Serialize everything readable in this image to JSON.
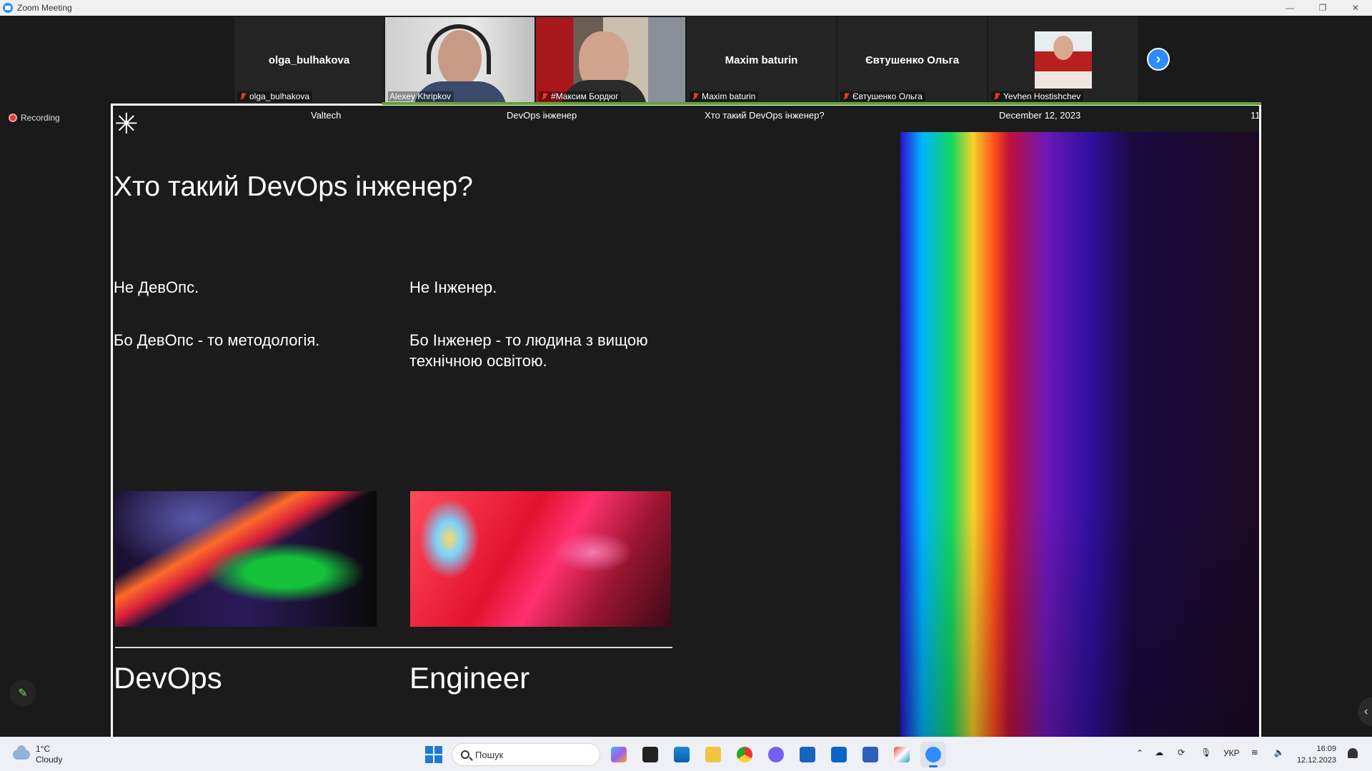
{
  "window": {
    "title": "Zoom Meeting"
  },
  "participants": [
    {
      "name": "olga_bulhakova",
      "center_name": "olga_bulhakova",
      "muted": true,
      "video": false
    },
    {
      "name": "Alexey Khripkov",
      "muted": false,
      "video": true,
      "active_speaker": true
    },
    {
      "name": "#Максим Бордюг",
      "muted": true,
      "video": true
    },
    {
      "name": "Maxim baturin",
      "center_name": "Maxim baturin",
      "muted": true,
      "video": false
    },
    {
      "name": "Євтушенко Ольга",
      "center_name": "Євтушенко Ольга",
      "muted": true,
      "video": false
    },
    {
      "name": "Yevhen Hostishchev",
      "muted": true,
      "video": false,
      "avatar": true
    }
  ],
  "recording": {
    "label": "Recording"
  },
  "slide": {
    "header": {
      "company": "Valtech",
      "section": "DevOps інженер",
      "topic": "Хто такий DevOps інженер?",
      "date": "December 12, 2023",
      "page": "11"
    },
    "title": "Хто такий DevOps інженер?",
    "col1": {
      "line1": "Не ДевОпс.",
      "line2": "Бо ДевОпс - то методологія."
    },
    "col2": {
      "line1": "Не Інженер.",
      "line2a": "Бо Інженер - то людина з вищою",
      "line2b": "технічною освітою."
    },
    "word1": "DevOps",
    "word2": "Engineer"
  },
  "taskbar": {
    "weather": {
      "temp": "1°C",
      "condition": "Cloudy"
    },
    "search_placeholder": "Пошук",
    "apps": [
      "copilot",
      "task-view",
      "store",
      "file-explorer",
      "chrome",
      "viber",
      "remote-desktop",
      "outlook",
      "word",
      "snipping-tool",
      "zoom"
    ],
    "language": "УКР",
    "time": "16:09",
    "date": "12.12.2023"
  },
  "colors": {
    "zoom_blue": "#2d8cff",
    "active_speaker": "#8bc34a",
    "mute_red": "#e53935"
  }
}
